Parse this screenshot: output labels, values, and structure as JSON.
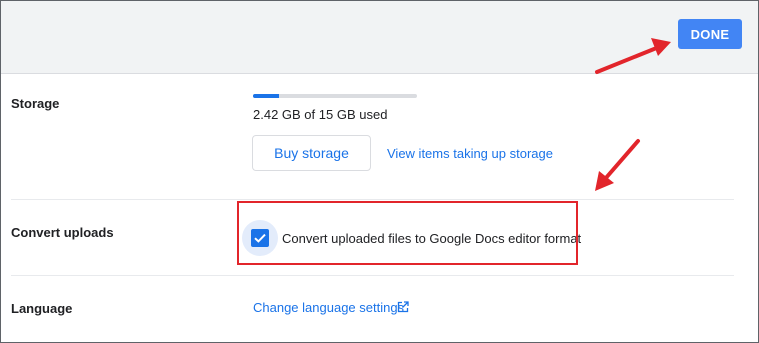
{
  "header": {
    "done_label": "DONE"
  },
  "storage": {
    "label": "Storage",
    "used_fraction": 0.161,
    "usage_text": "2.42 GB of 15 GB used",
    "buy_label": "Buy storage",
    "view_items_label": "View items taking up storage"
  },
  "convert": {
    "label": "Convert uploads",
    "checked": true,
    "checkbox_label": "Convert uploaded files to Google Docs editor format"
  },
  "language": {
    "label": "Language",
    "link_label": "Change language settings",
    "link_icon": "open-in-new-icon"
  },
  "colors": {
    "accent": "#1a73e8",
    "done_button": "#4285f4",
    "annotation": "#e2252b",
    "topbar": "#f1f3f4"
  }
}
